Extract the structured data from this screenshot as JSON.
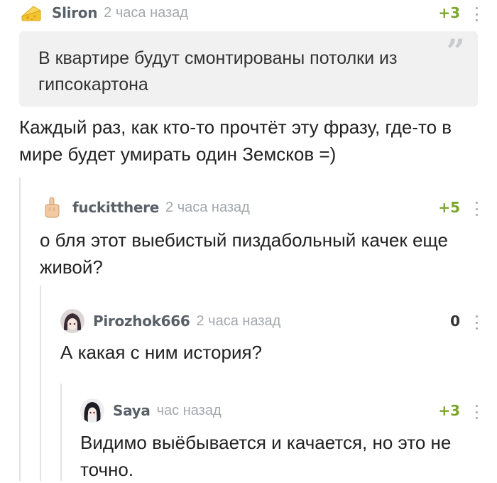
{
  "comments": [
    {
      "username": "Sliron",
      "time": "2 часа назад",
      "rating": "+3",
      "quote": "В квартире будут смонтированы потолки из гипсокартона",
      "quote_icon": "quote-icon",
      "text": "Каждый раз, как кто-то прочтёт эту фразу, где-то в мире будет умирать один Земсков =)",
      "avatar_icon": "cheese-avatar-icon"
    },
    {
      "username": "fuckitthere",
      "time": "2 часа назад",
      "rating": "+5",
      "text": "о бля этот выебистый пиздабольный качек еще живой?",
      "avatar_icon": "middle-finger-avatar-icon"
    },
    {
      "username": "Pirozhok666",
      "time": "2 часа назад",
      "rating": "0",
      "text": "А какая с ним история?",
      "avatar_icon": "anime-girl-avatar-icon"
    },
    {
      "username": "Saya",
      "time": "час назад",
      "rating": "+3",
      "text": "Видимо выёбывается и качается, но это не точно.",
      "avatar_icon": "anime-girl-avatar-icon"
    }
  ],
  "colors": {
    "positive_rating": "#7aa62b",
    "username": "#5a6068",
    "muted": "#a3a7ac",
    "quote_bg": "#f1f1f1",
    "thread_line": "#e3e3e3"
  }
}
